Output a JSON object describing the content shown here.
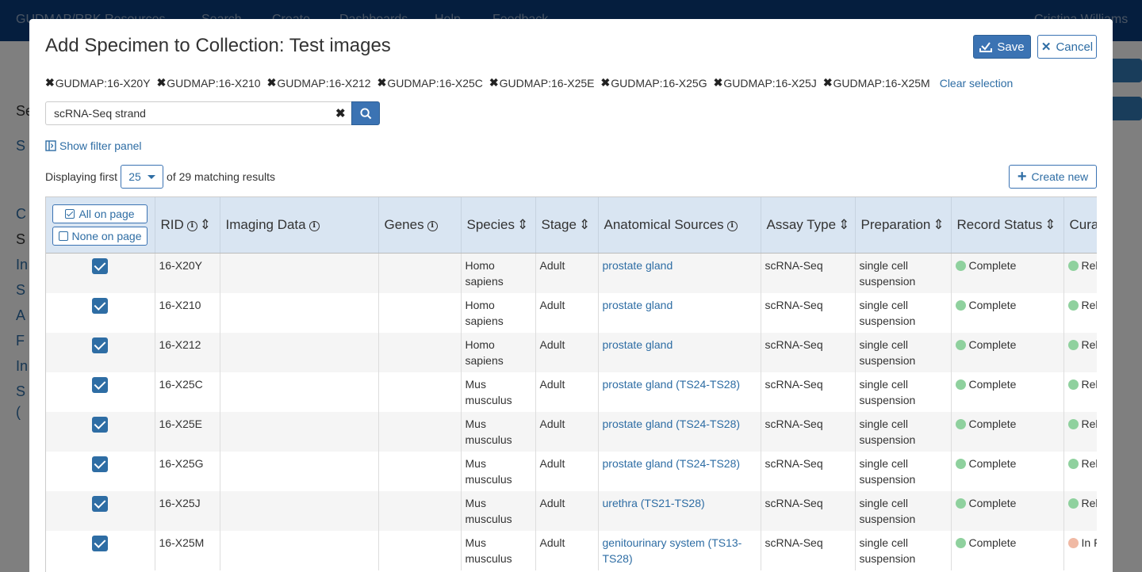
{
  "background": {
    "nav_items": [
      "GUDMAP/RBK Resources",
      "Search",
      "Create",
      "Dashboards",
      "Help",
      "Feedback"
    ],
    "user": "Cristina Williams",
    "side_letters": [
      "Se",
      "S",
      "C",
      "S",
      "In",
      "S",
      "A",
      "F",
      "In",
      "S",
      "("
    ]
  },
  "modal": {
    "title": "Add Specimen to Collection: Test images",
    "save_label": "Save",
    "cancel_label": "Cancel"
  },
  "selection": {
    "chips": [
      "GUDMAP:16-X20Y",
      "GUDMAP:16-X210",
      "GUDMAP:16-X212",
      "GUDMAP:16-X25C",
      "GUDMAP:16-X25E",
      "GUDMAP:16-X25G",
      "GUDMAP:16-X25J",
      "GUDMAP:16-X25M"
    ],
    "clear_label": "Clear selection"
  },
  "search": {
    "value": "scRNA-Seq strand"
  },
  "filter_link": "Show filter panel",
  "display": {
    "prefix": "Displaying first",
    "page_size": "25",
    "suffix": "of 29 matching results"
  },
  "create_label": "Create new",
  "table": {
    "all_on_page": "All on page",
    "none_on_page": "None on page",
    "columns": [
      "RID",
      "Imaging Data",
      "Genes",
      "Species",
      "Stage",
      "Anatomical Sources",
      "Assay Type",
      "Preparation",
      "Record Status",
      "Cura"
    ],
    "rows": [
      {
        "rid": "16-X20Y",
        "imaging": "",
        "genes": "",
        "species": "Homo sapiens",
        "stage": "Adult",
        "anatomical": "prostate gland",
        "assay": "scRNA-Seq",
        "prep": "single cell suspension",
        "status": "Complete",
        "curation": "Rel"
      },
      {
        "rid": "16-X210",
        "imaging": "",
        "genes": "",
        "species": "Homo sapiens",
        "stage": "Adult",
        "anatomical": "prostate gland",
        "assay": "scRNA-Seq",
        "prep": "single cell suspension",
        "status": "Complete",
        "curation": "Rel"
      },
      {
        "rid": "16-X212",
        "imaging": "",
        "genes": "",
        "species": "Homo sapiens",
        "stage": "Adult",
        "anatomical": "prostate gland",
        "assay": "scRNA-Seq",
        "prep": "single cell suspension",
        "status": "Complete",
        "curation": "Rel"
      },
      {
        "rid": "16-X25C",
        "imaging": "",
        "genes": "",
        "species": "Mus musculus",
        "stage": "Adult",
        "anatomical": "prostate gland (TS24-TS28)",
        "assay": "scRNA-Seq",
        "prep": "single cell suspension",
        "status": "Complete",
        "curation": "Rel"
      },
      {
        "rid": "16-X25E",
        "imaging": "",
        "genes": "",
        "species": "Mus musculus",
        "stage": "Adult",
        "anatomical": "prostate gland (TS24-TS28)",
        "assay": "scRNA-Seq",
        "prep": "single cell suspension",
        "status": "Complete",
        "curation": "Rel"
      },
      {
        "rid": "16-X25G",
        "imaging": "",
        "genes": "",
        "species": "Mus musculus",
        "stage": "Adult",
        "anatomical": "prostate gland (TS24-TS28)",
        "assay": "scRNA-Seq",
        "prep": "single cell suspension",
        "status": "Complete",
        "curation": "Rel"
      },
      {
        "rid": "16-X25J",
        "imaging": "",
        "genes": "",
        "species": "Mus musculus",
        "stage": "Adult",
        "anatomical": "urethra (TS21-TS28)",
        "assay": "scRNA-Seq",
        "prep": "single cell suspension",
        "status": "Complete",
        "curation": "Rel"
      },
      {
        "rid": "16-X25M",
        "imaging": "",
        "genes": "",
        "species": "Mus musculus",
        "stage": "Adult",
        "anatomical": "genitourinary system (TS13-TS28)",
        "assay": "scRNA-Seq",
        "prep": "single cell suspension",
        "status": "Complete",
        "curation": "In F"
      }
    ]
  },
  "colors": {
    "primary": "#3b73b3",
    "header_bg": "#d9e5f2",
    "status_complete": "#8fd19e",
    "status_inprogress": "#f0b9a4"
  }
}
